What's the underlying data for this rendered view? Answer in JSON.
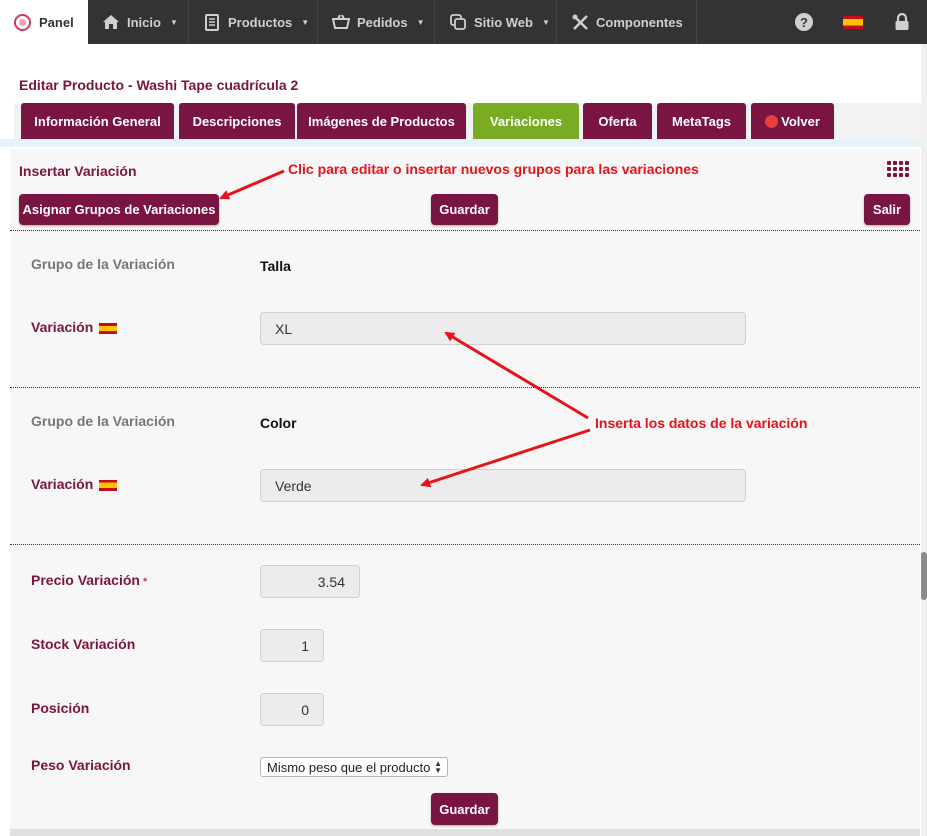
{
  "nav": {
    "panel_label": "Panel",
    "items": [
      {
        "label": "Inicio",
        "icon": "home-icon"
      },
      {
        "label": "Productos",
        "icon": "book-icon"
      },
      {
        "label": "Pedidos",
        "icon": "basket-icon"
      },
      {
        "label": "Sitio Web",
        "icon": "copy-icon"
      },
      {
        "label": "Componentes",
        "icon": "tools-icon"
      }
    ],
    "right_icons": [
      "help-icon",
      "spain-flag-icon",
      "lock-icon"
    ]
  },
  "page_title": "Editar Producto - Washi Tape cuadrícula 2",
  "tabs": [
    {
      "label": "Información General",
      "active": false
    },
    {
      "label": "Descripciones",
      "active": false
    },
    {
      "label": "Imágenes de Productos",
      "active": false
    },
    {
      "label": "Variaciones",
      "active": true
    },
    {
      "label": "Oferta",
      "active": false
    },
    {
      "label": "MetaTags",
      "active": false
    },
    {
      "label": "Volver",
      "active": false
    }
  ],
  "section_title": "Insertar Variación",
  "buttons": {
    "assign_groups": "Asignar Grupos de Variaciones",
    "save": "Guardar",
    "exit": "Salir",
    "save_bottom": "Guardar"
  },
  "groups": [
    {
      "group_label": "Grupo de la Variación",
      "group_value": "Talla",
      "variation_label": "Variación",
      "variation_value": "XL"
    },
    {
      "group_label": "Grupo de la Variación",
      "group_value": "Color",
      "variation_label": "Variación",
      "variation_value": "Verde"
    }
  ],
  "fields": {
    "price_label": "Precio Variación",
    "price_required": "*",
    "price_value": "3.54",
    "stock_label": "Stock Variación",
    "stock_value": "1",
    "position_label": "Posición",
    "position_value": "0",
    "weight_label": "Peso Variación",
    "weight_value": "Mismo peso que el producto"
  },
  "annotations": {
    "groups_hint": "Clic para editar o insertar nuevos grupos para las variaciones",
    "data_hint": "Inserta los datos de la variación"
  },
  "colors": {
    "brand": "#7a1440",
    "active_tab": "#7aac23",
    "annotation": "#e8121a",
    "nav_bg": "#333333"
  }
}
